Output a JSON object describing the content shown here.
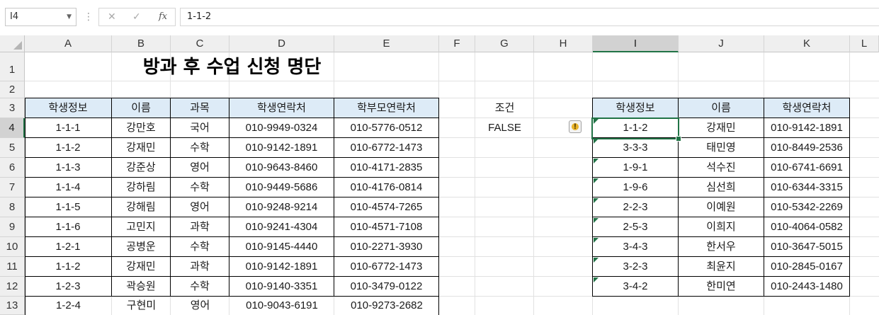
{
  "formula_bar": {
    "name_box": "I4",
    "formula": "1-1-2",
    "cancel_icon": "✕",
    "confirm_icon": "✓",
    "fx_label": "fx"
  },
  "columns": [
    "A",
    "B",
    "C",
    "D",
    "E",
    "F",
    "G",
    "H",
    "I",
    "J",
    "K",
    "L"
  ],
  "rows": [
    "1",
    "2",
    "3",
    "4",
    "5",
    "6",
    "7",
    "8",
    "9",
    "10",
    "11",
    "12",
    "13"
  ],
  "title": "방과 후 수업 신청 명단",
  "main_table": {
    "headers": [
      "학생정보",
      "이름",
      "과목",
      "학생연락처",
      "학부모연락처"
    ],
    "rows": [
      [
        "1-1-1",
        "강만호",
        "국어",
        "010-9949-0324",
        "010-5776-0512"
      ],
      [
        "1-1-2",
        "강재민",
        "수학",
        "010-9142-1891",
        "010-6772-1473"
      ],
      [
        "1-1-3",
        "강준상",
        "영어",
        "010-9643-8460",
        "010-4171-2835"
      ],
      [
        "1-1-4",
        "강하림",
        "수학",
        "010-9449-5686",
        "010-4176-0814"
      ],
      [
        "1-1-5",
        "강해림",
        "영어",
        "010-9248-9214",
        "010-4574-7265"
      ],
      [
        "1-1-6",
        "고민지",
        "과학",
        "010-9241-4304",
        "010-4571-7108"
      ],
      [
        "1-2-1",
        "공병운",
        "수학",
        "010-9145-4440",
        "010-2271-3930"
      ],
      [
        "1-1-2",
        "강재민",
        "과학",
        "010-9142-1891",
        "010-6772-1473"
      ],
      [
        "1-2-3",
        "곽승원",
        "수학",
        "010-9140-3351",
        "010-3479-0122"
      ],
      [
        "1-2-4",
        "구현미",
        "영어",
        "010-9043-6191",
        "010-9273-2682"
      ]
    ]
  },
  "condition": {
    "label": "조건",
    "value": "FALSE"
  },
  "result_table": {
    "headers": [
      "학생정보",
      "이름",
      "학생연락처"
    ],
    "rows": [
      [
        "1-1-2",
        "강재민",
        "010-9142-1891"
      ],
      [
        "3-3-3",
        "태민영",
        "010-8449-2536"
      ],
      [
        "1-9-1",
        "석수진",
        "010-6741-6691"
      ],
      [
        "1-9-6",
        "심선희",
        "010-6344-3315"
      ],
      [
        "2-2-3",
        "이예원",
        "010-5342-2269"
      ],
      [
        "2-5-3",
        "이희지",
        "010-4064-0582"
      ],
      [
        "3-4-3",
        "한서우",
        "010-3647-5015"
      ],
      [
        "3-2-3",
        "최윤지",
        "010-2845-0167"
      ],
      [
        "3-4-2",
        "한미연",
        "010-2443-1480"
      ]
    ]
  },
  "colors": {
    "header_fill": "#ddebf7",
    "selection": "#217346",
    "warning": "#e8b32a"
  },
  "icons": {
    "warning_icon": "!"
  }
}
